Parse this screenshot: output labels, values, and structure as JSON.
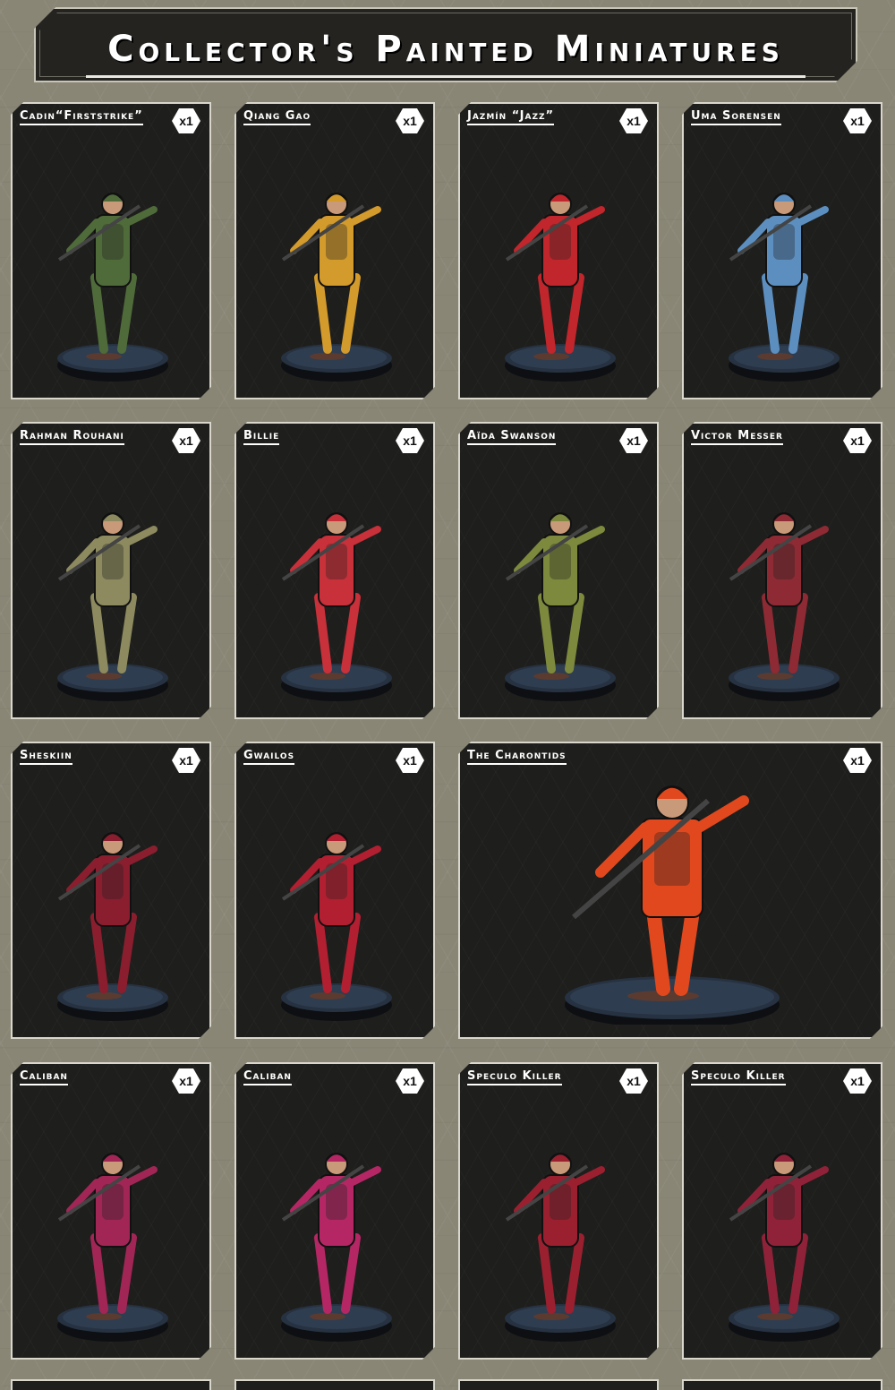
{
  "page": {
    "title": "Collector's Painted Miniatures",
    "background_color": "#8a8676",
    "card_color": "#1e1e1c"
  },
  "cards": [
    {
      "name": "Cadin“Firststrike”",
      "qty": "x1",
      "icon": "miniature-figure",
      "accent": "#4f6b3a"
    },
    {
      "name": "Qiang Gao",
      "qty": "x1",
      "icon": "miniature-figure",
      "accent": "#d39a2c"
    },
    {
      "name": "Jazmín “Jazz”",
      "qty": "x1",
      "icon": "miniature-figure",
      "accent": "#c0262b"
    },
    {
      "name": "Uma Sorensen",
      "qty": "x1",
      "icon": "miniature-figure",
      "accent": "#5c8fc0"
    },
    {
      "name": "Rahman Rouhani",
      "qty": "x1",
      "icon": "miniature-figure",
      "accent": "#8c8a5e"
    },
    {
      "name": "Billie",
      "qty": "x1",
      "icon": "miniature-figure",
      "accent": "#c8303a"
    },
    {
      "name": "Aïda Swanson",
      "qty": "x1",
      "icon": "miniature-figure",
      "accent": "#7d8a3d"
    },
    {
      "name": "Victor Messer",
      "qty": "x1",
      "icon": "miniature-figure",
      "accent": "#8e2a33"
    },
    {
      "name": "Sheskiin",
      "qty": "x1",
      "icon": "miniature-figure",
      "accent": "#8a1e2e"
    },
    {
      "name": "Gwailos",
      "qty": "x1",
      "icon": "miniature-figure",
      "accent": "#b21f31"
    },
    {
      "name": "The Charontids",
      "qty": "x1",
      "icon": "miniature-figure",
      "accent": "#e1481e"
    },
    {
      "name": "Caliban",
      "qty": "x1",
      "icon": "miniature-figure",
      "accent": "#a12655"
    },
    {
      "name": "Caliban",
      "qty": "x1",
      "icon": "miniature-figure",
      "accent": "#b52764"
    },
    {
      "name": "Speculo Killer",
      "qty": "x1",
      "icon": "miniature-figure",
      "accent": "#9a2030"
    },
    {
      "name": "Speculo Killer",
      "qty": "x1",
      "icon": "miniature-figure",
      "accent": "#8f2238"
    }
  ]
}
